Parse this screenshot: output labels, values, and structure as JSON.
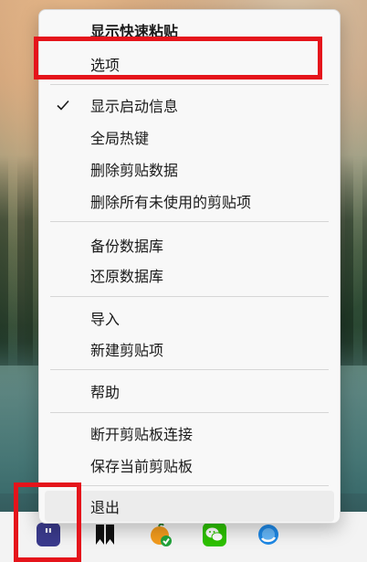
{
  "menu": {
    "title": "显示快速粘贴",
    "items": [
      {
        "label": "选项"
      },
      {
        "label": "显示启动信息",
        "checked": true
      },
      {
        "label": "全局热键"
      },
      {
        "label": "删除剪贴数据"
      },
      {
        "label": "删除所有未使用的剪贴项"
      },
      {
        "label": "备份数据库"
      },
      {
        "label": "还原数据库"
      },
      {
        "label": "导入"
      },
      {
        "label": "新建剪贴项"
      },
      {
        "label": "帮助"
      },
      {
        "label": "断开剪贴板连接"
      },
      {
        "label": "保存当前剪贴板"
      },
      {
        "label": "退出"
      }
    ]
  },
  "taskbar": {
    "apps": [
      {
        "icon": "clipboard-app-quote-icon",
        "glyph": "\""
      },
      {
        "icon": "bookmark-app-icon"
      },
      {
        "icon": "orange-check-app-icon"
      },
      {
        "icon": "wechat-icon"
      },
      {
        "icon": "browser-icon"
      }
    ]
  },
  "colors": {
    "highlight_box": "#e5141b",
    "menu_bg": "#f8f8f8",
    "taskbar_bg": "#f3f3f3",
    "quote_app": "#3a3a8c",
    "wechat": "#2dc100"
  }
}
